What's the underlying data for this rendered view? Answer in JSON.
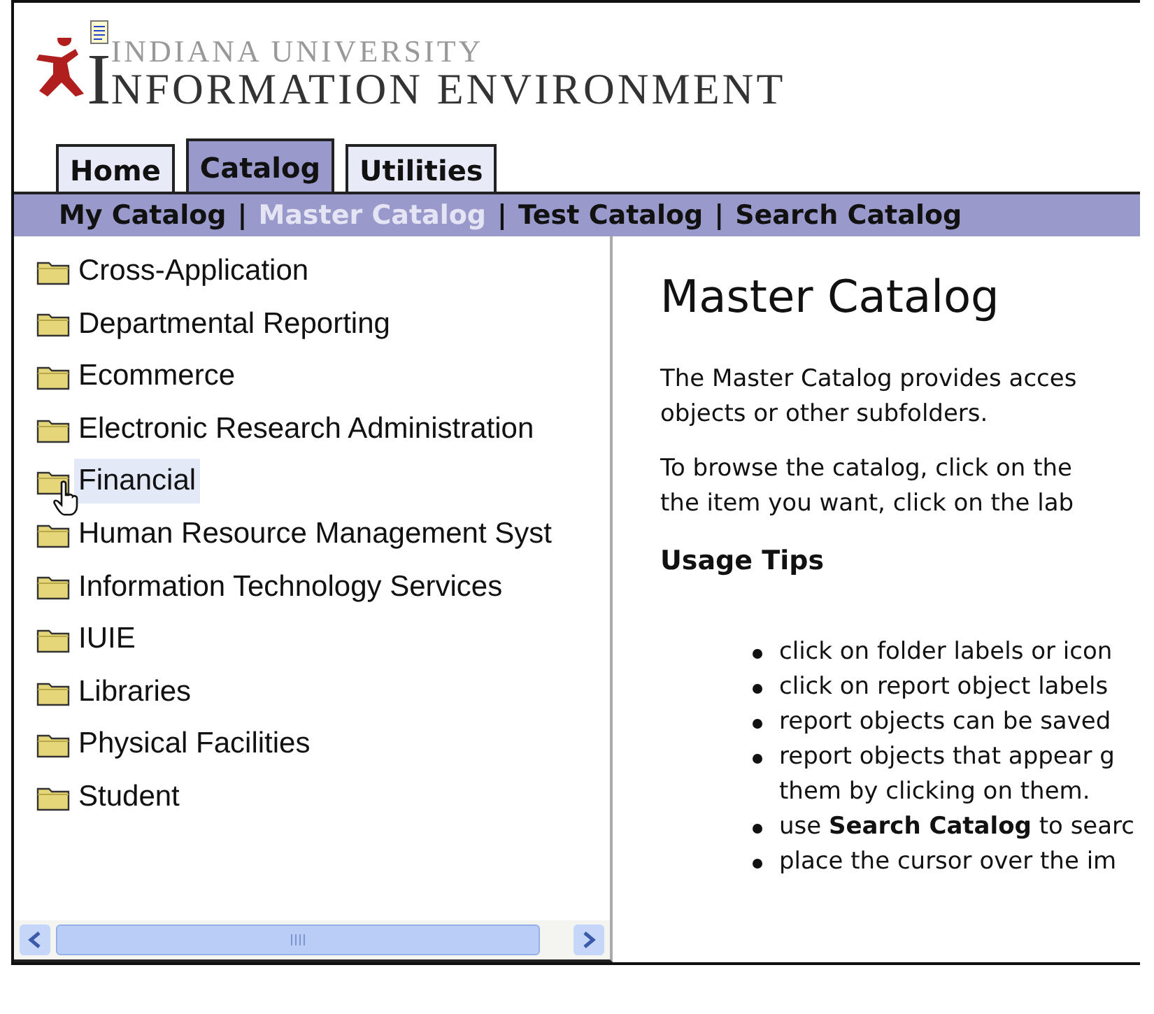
{
  "logo": {
    "line_1": "INDIANA UNIVERSITY",
    "line_2": "NFORMATION ENVIRONMENT",
    "initial": "I"
  },
  "tabs": [
    {
      "label": "Home",
      "selected": false
    },
    {
      "label": "Catalog",
      "selected": true
    },
    {
      "label": "Utilities",
      "selected": false
    }
  ],
  "subnav": {
    "items": [
      {
        "label": "My Catalog",
        "selected": false
      },
      {
        "label": "Master Catalog",
        "selected": true
      },
      {
        "label": "Test Catalog",
        "selected": false
      },
      {
        "label": "Search Catalog",
        "selected": false
      }
    ],
    "separators": [
      "|",
      "|",
      "|"
    ]
  },
  "tree": {
    "items": [
      {
        "label": "Cross-Application",
        "selected": false
      },
      {
        "label": "Departmental Reporting",
        "selected": false
      },
      {
        "label": "Ecommerce",
        "selected": false
      },
      {
        "label": "Electronic Research Administration",
        "selected": false
      },
      {
        "label": "Financial",
        "selected": true
      },
      {
        "label": "Human Resource Management Syst",
        "selected": false
      },
      {
        "label": "Information Technology Services",
        "selected": false
      },
      {
        "label": "IUIE",
        "selected": false
      },
      {
        "label": "Libraries",
        "selected": false
      },
      {
        "label": "Physical Facilities",
        "selected": false
      },
      {
        "label": "Student",
        "selected": false
      }
    ]
  },
  "content": {
    "title": "Master Catalog",
    "paragraphs": [
      [
        "The Master Catalog provides acces",
        "objects or other subfolders."
      ],
      [
        "To browse the catalog, click on the",
        "the item you want, click on the lab"
      ]
    ],
    "subheading": "Usage Tips",
    "tips": [
      [
        "click on folder labels or icon"
      ],
      [
        "click on report object labels"
      ],
      [
        "report objects can be saved"
      ],
      [
        "report objects that appear g",
        "them by clicking on them."
      ],
      [
        "use **Search Catalog** to searc"
      ],
      [
        "place the cursor over the im"
      ]
    ]
  }
}
